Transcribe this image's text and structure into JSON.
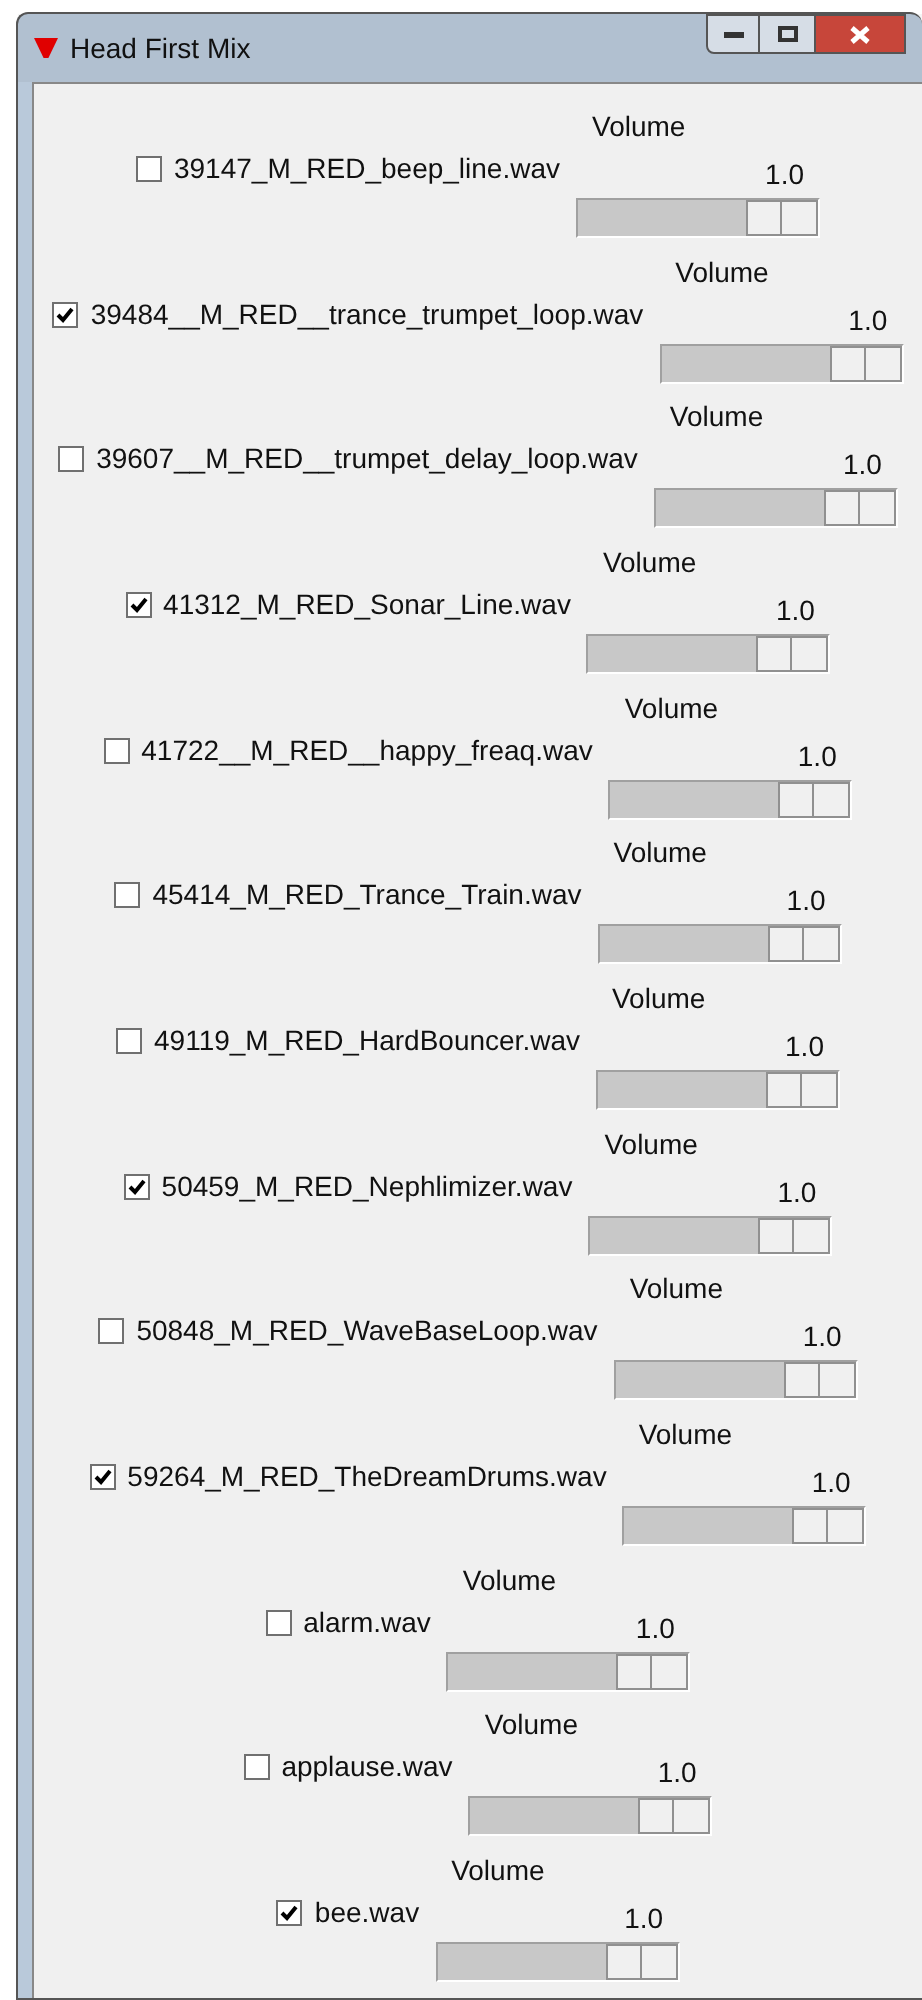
{
  "window": {
    "title": "Head First Mix"
  },
  "tracks": [
    {
      "name": "39147_M_RED_beep_line.wav",
      "checked": false,
      "scale_label": "Volume",
      "value": "1.0",
      "level": 1
    },
    {
      "name": "39484__M_RED__trance_trumpet_loop.wav",
      "checked": true,
      "scale_label": "Volume",
      "value": "1.0",
      "level": 1
    },
    {
      "name": "39607__M_RED__trumpet_delay_loop.wav",
      "checked": false,
      "scale_label": "Volume",
      "value": "1.0",
      "level": 1
    },
    {
      "name": "41312_M_RED_Sonar_Line.wav",
      "checked": true,
      "scale_label": "Volume",
      "value": "1.0",
      "level": 1
    },
    {
      "name": "41722__M_RED__happy_freaq.wav",
      "checked": false,
      "scale_label": "Volume",
      "value": "1.0",
      "level": 1
    },
    {
      "name": "45414_M_RED_Trance_Train.wav",
      "checked": false,
      "scale_label": "Volume",
      "value": "1.0",
      "level": 1
    },
    {
      "name": "49119_M_RED_HardBouncer.wav",
      "checked": false,
      "scale_label": "Volume",
      "value": "1.0",
      "level": 1
    },
    {
      "name": "50459_M_RED_Nephlimizer.wav",
      "checked": true,
      "scale_label": "Volume",
      "value": "1.0",
      "level": 1
    },
    {
      "name": "50848_M_RED_WaveBaseLoop.wav",
      "checked": false,
      "scale_label": "Volume",
      "value": "1.0",
      "level": 1
    },
    {
      "name": "59264_M_RED_TheDreamDrums.wav",
      "checked": true,
      "scale_label": "Volume",
      "value": "1.0",
      "level": 1
    },
    {
      "name": "alarm.wav",
      "checked": false,
      "scale_label": "Volume",
      "value": "1.0",
      "level": 1
    },
    {
      "name": "applause.wav",
      "checked": false,
      "scale_label": "Volume",
      "value": "1.0",
      "level": 1
    },
    {
      "name": "bee.wav",
      "checked": true,
      "scale_label": "Volume",
      "value": "1.0",
      "level": 1
    }
  ]
}
